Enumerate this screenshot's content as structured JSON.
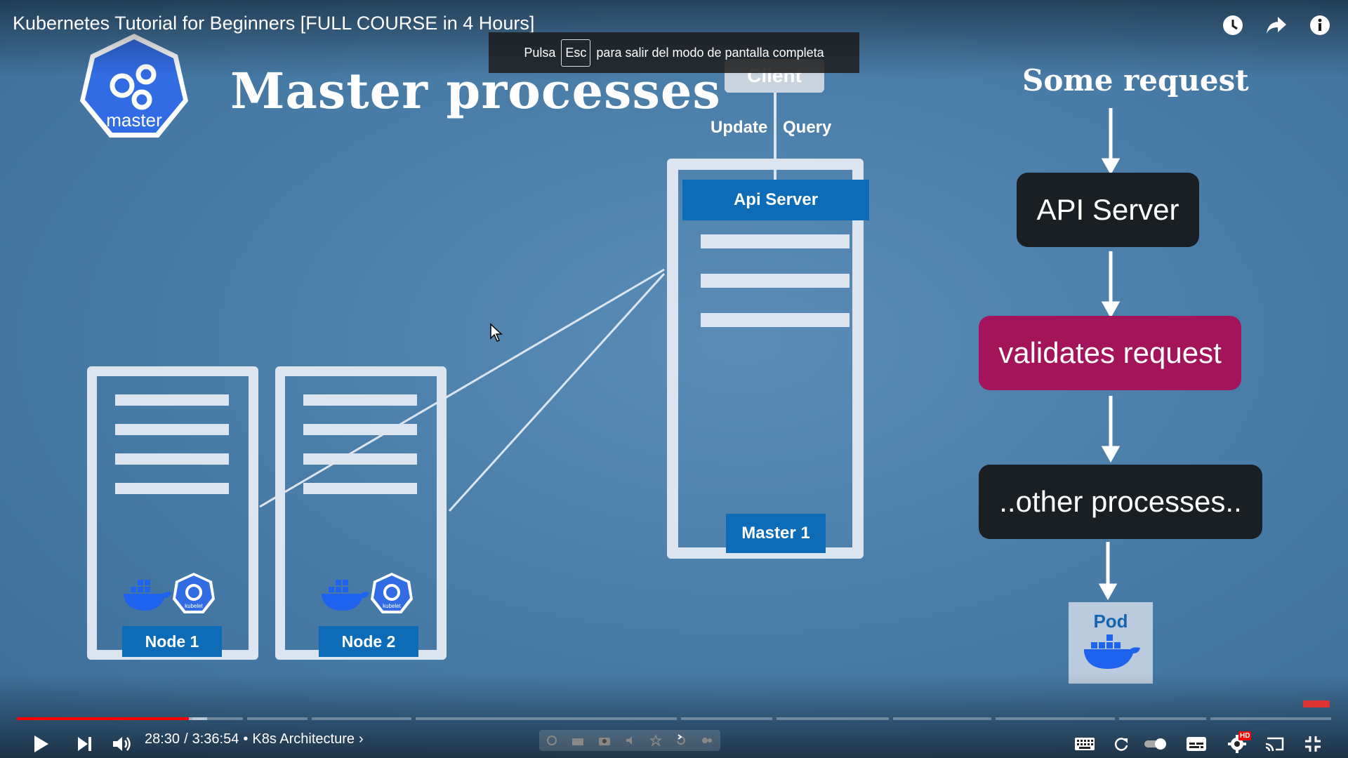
{
  "player": {
    "title": "Kubernetes Tutorial for Beginners [FULL COURSE in 4 Hours]",
    "fullscreen_toast": {
      "before": "Pulsa",
      "key": "Esc",
      "after": "para salir del modo de pantalla completa"
    },
    "top_actions": [
      "watch-later-icon",
      "share-icon",
      "info-icon"
    ],
    "progress": {
      "played_fraction": 0.131,
      "buffered_fraction": 0.145
    },
    "time_current": "28:30",
    "time_separator": "/",
    "time_total": "3:36:54",
    "bullet": "•",
    "chapter": "K8s Architecture",
    "chapter_chevron": "›",
    "badge": "HD",
    "accent_color": "#ff0000"
  },
  "slide": {
    "logo_text": "master",
    "title": "Master processes",
    "client_label": "Client",
    "update_label": "Update",
    "query_label": "Query",
    "api_server_label": "Api Server",
    "master_label": "Master 1",
    "nodes": [
      {
        "label": "Node 1",
        "kubelet": "kubelet"
      },
      {
        "label": "Node 2",
        "kubelet": "kubelet"
      }
    ],
    "flow": {
      "heading": "Some request",
      "steps": [
        "API Server",
        "validates request",
        "..other processes.."
      ],
      "pod_label": "Pod"
    },
    "colors": {
      "background": "#4a7ea9",
      "blue": "#0d6cb8",
      "magenta": "#a3145a",
      "dark": "#1a1f24"
    }
  }
}
